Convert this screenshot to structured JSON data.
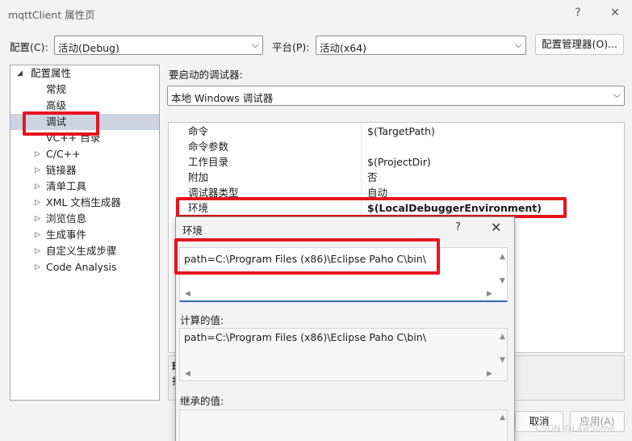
{
  "window": {
    "title": "mqttClient 属性页",
    "help_glyph": "?",
    "close_glyph": "✕"
  },
  "config_row": {
    "config_label": "配置(C):",
    "config_value": "活动(Debug)",
    "platform_label": "平台(P):",
    "platform_value": "活动(x64)",
    "manager_button": "配置管理器(O)..."
  },
  "tree": {
    "root_label": "配置属性",
    "items": [
      {
        "label": "常规",
        "expandable": false
      },
      {
        "label": "高级",
        "expandable": false
      },
      {
        "label": "调试",
        "expandable": false,
        "selected": true
      },
      {
        "label": "VC++ 目录",
        "expandable": false
      },
      {
        "label": "C/C++",
        "expandable": true
      },
      {
        "label": "链接器",
        "expandable": true
      },
      {
        "label": "清单工具",
        "expandable": true
      },
      {
        "label": "XML 文档生成器",
        "expandable": true
      },
      {
        "label": "浏览信息",
        "expandable": true
      },
      {
        "label": "生成事件",
        "expandable": true
      },
      {
        "label": "自定义生成步骤",
        "expandable": true
      },
      {
        "label": "Code Analysis",
        "expandable": true
      }
    ]
  },
  "debugger": {
    "section_label": "要启动的调试器:",
    "selected": "本地 Windows 调试器"
  },
  "properties": [
    {
      "key": "命令",
      "value": "$(TargetPath)"
    },
    {
      "key": "命令参数",
      "value": ""
    },
    {
      "key": "工作目录",
      "value": "$(ProjectDir)"
    },
    {
      "key": "附加",
      "value": "否"
    },
    {
      "key": "调试器类型",
      "value": "自动"
    },
    {
      "key": "环境",
      "value": "$(LocalDebuggerEnvironment)"
    }
  ],
  "description_fragments": [
    "环",
    "打"
  ],
  "footer": {
    "cancel_button": "取消",
    "apply_button": "应用(A)"
  },
  "env_dialog": {
    "title": "环境",
    "help_glyph": "?",
    "close_glyph": "✕",
    "edit_value": "path=C:\\Program Files (x86)\\Eclipse Paho C\\bin\\",
    "evaluated_label": "计算的值:",
    "evaluated_value": "path=C:\\Program Files (x86)\\Eclipse Paho C\\bin\\",
    "inherited_label": "继承的值:"
  },
  "watermark": "CSDN @LawSome",
  "colors": {
    "highlight_red": "#e6141e",
    "selection": "#ccd3e1",
    "focus_blue": "#2e6ab6"
  }
}
